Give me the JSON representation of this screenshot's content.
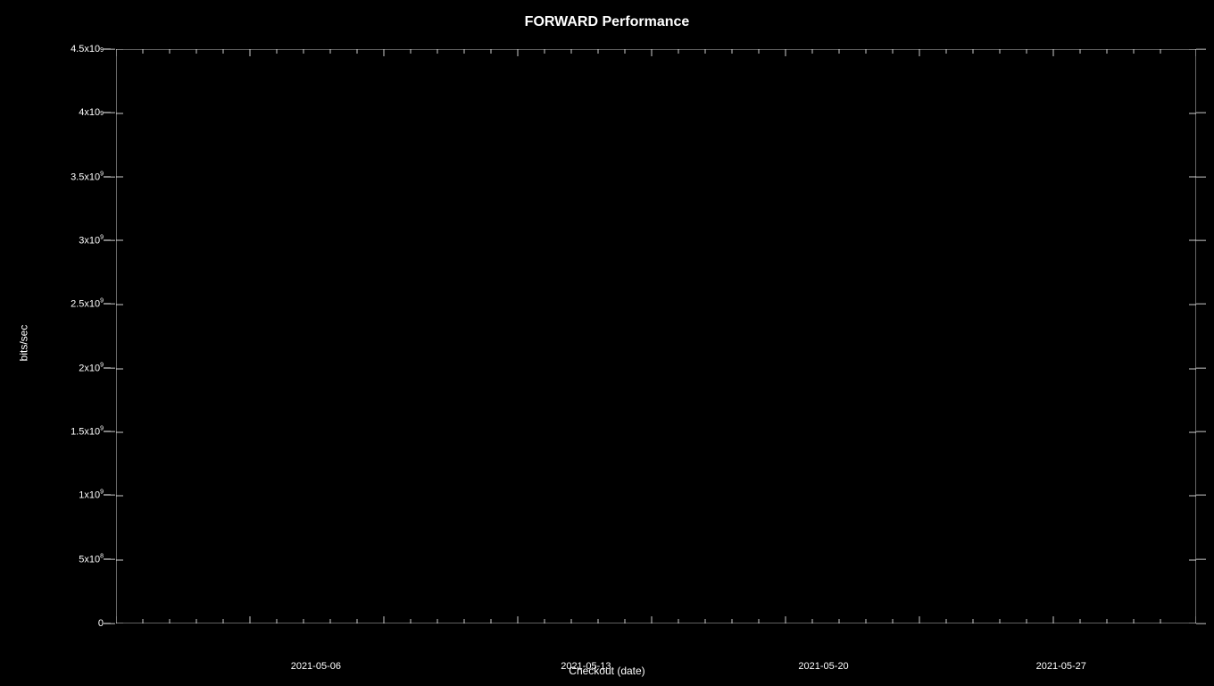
{
  "chart": {
    "title": "FORWARD Performance",
    "y_axis_label": "bits/sec",
    "x_axis_label": "Checkout (date)",
    "y_ticks": [
      {
        "value": "4.5x10⁹",
        "label": "4.5x10",
        "exp": "9",
        "percent": 100
      },
      {
        "value": "4x10⁹",
        "label": "4x10",
        "exp": "9",
        "percent": 88.9
      },
      {
        "value": "3.5x10⁹",
        "label": "3.5x10",
        "exp": "9",
        "percent": 77.8
      },
      {
        "value": "3x10⁹",
        "label": "3x10",
        "exp": "9",
        "percent": 66.7
      },
      {
        "value": "2.5x10⁹",
        "label": "2.5x10",
        "exp": "9",
        "percent": 55.6
      },
      {
        "value": "2x10⁹",
        "label": "2x10",
        "exp": "9",
        "percent": 44.4
      },
      {
        "value": "1.5x10⁹",
        "label": "1.5x10",
        "exp": "9",
        "percent": 33.3
      },
      {
        "value": "1x10⁹",
        "label": "1x10",
        "exp": "9",
        "percent": 22.2
      },
      {
        "value": "5x10⁸",
        "label": "5x10",
        "exp": "8",
        "percent": 11.1
      },
      {
        "value": "0",
        "label": "0",
        "exp": "",
        "percent": 0
      }
    ],
    "x_ticks": [
      {
        "label": "2021-05-06",
        "percent": 18.5
      },
      {
        "label": "2021-05-13",
        "percent": 43.5
      },
      {
        "label": "2021-05-20",
        "percent": 65.5
      },
      {
        "label": "2021-05-27",
        "percent": 87.5
      }
    ]
  }
}
